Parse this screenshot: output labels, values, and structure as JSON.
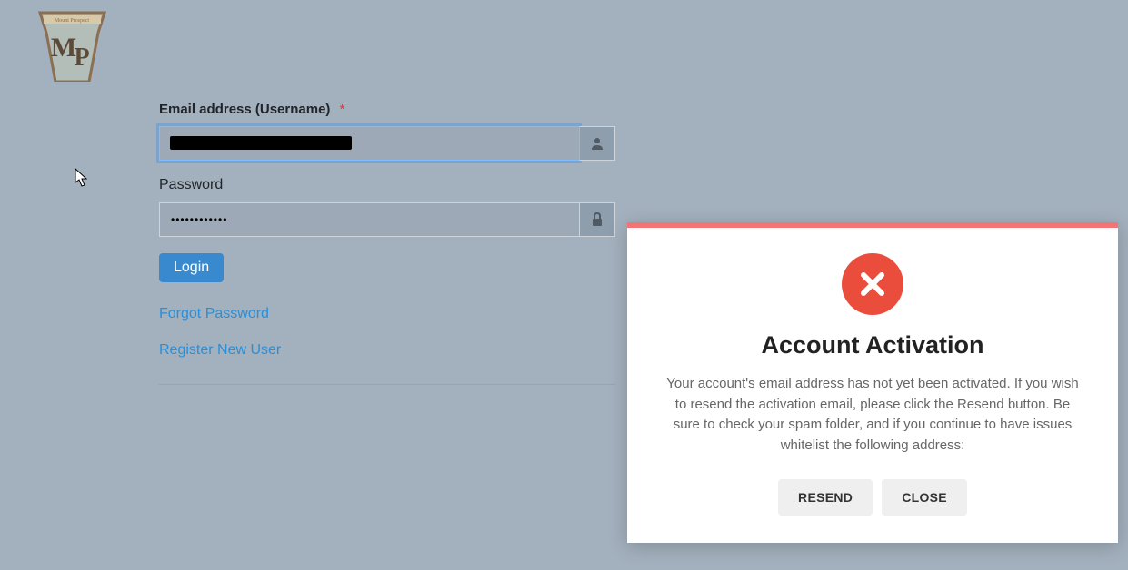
{
  "logo": {
    "text_top": "Mount Prospect",
    "letter_left": "M",
    "letter_right": "P"
  },
  "form": {
    "email_label": "Email address (Username)",
    "required_mark": "*",
    "email_value": "",
    "password_label": "Password",
    "password_value": "••••••••••••",
    "login_button": "Login",
    "forgot_link": "Forgot Password",
    "register_link": "Register New User"
  },
  "modal": {
    "title": "Account Activation",
    "message": "Your account's email address has not yet been activated. If you wish to resend the activation email, please click the Resend button. Be sure to check your spam folder, and if you continue to have issues whitelist the following address:",
    "resend_button": "RESEND",
    "close_button": "CLOSE"
  }
}
